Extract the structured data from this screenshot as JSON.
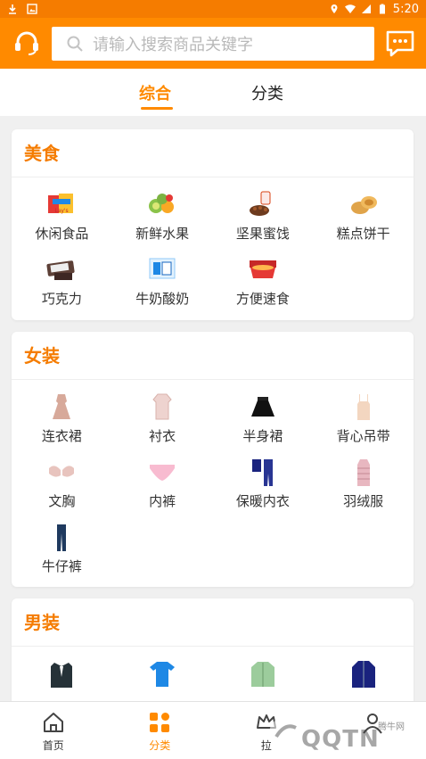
{
  "status_bar": {
    "time": "5:20"
  },
  "search": {
    "placeholder": "请输入搜索商品关键字"
  },
  "tabs": [
    {
      "label": "综合"
    },
    {
      "label": "分类"
    }
  ],
  "sections": [
    {
      "title": "美食",
      "items": [
        {
          "label": "休闲食品",
          "icon": "snacks-icon"
        },
        {
          "label": "新鲜水果",
          "icon": "fruit-icon"
        },
        {
          "label": "坚果蜜饯",
          "icon": "nuts-icon"
        },
        {
          "label": "糕点饼干",
          "icon": "pastry-icon"
        },
        {
          "label": "巧克力",
          "icon": "chocolate-icon"
        },
        {
          "label": "牛奶酸奶",
          "icon": "milk-icon"
        },
        {
          "label": "方便速食",
          "icon": "instant-food-icon"
        }
      ]
    },
    {
      "title": "女装",
      "items": [
        {
          "label": "连衣裙",
          "icon": "dress-icon"
        },
        {
          "label": "衬衣",
          "icon": "blouse-icon"
        },
        {
          "label": "半身裙",
          "icon": "skirt-icon"
        },
        {
          "label": "背心吊带",
          "icon": "camisole-icon"
        },
        {
          "label": "文胸",
          "icon": "bra-icon"
        },
        {
          "label": "内裤",
          "icon": "underwear-icon"
        },
        {
          "label": "保暖内衣",
          "icon": "thermal-wear-icon"
        },
        {
          "label": "羽绒服",
          "icon": "down-coat-icon"
        },
        {
          "label": "牛仔裤",
          "icon": "jeans-icon"
        }
      ]
    },
    {
      "title": "男装",
      "items": [
        {
          "label": "",
          "icon": "suit-icon"
        },
        {
          "label": "",
          "icon": "tshirt-icon"
        },
        {
          "label": "",
          "icon": "shirt-icon"
        },
        {
          "label": "",
          "icon": "jacket-icon"
        }
      ]
    }
  ],
  "bottom_nav": [
    {
      "label": "首页",
      "icon": "home-icon"
    },
    {
      "label": "分类",
      "icon": "category-icon",
      "active": true
    },
    {
      "label": "拉",
      "icon": "crown-icon"
    },
    {
      "label": "",
      "icon": "profile-icon"
    }
  ],
  "watermark": {
    "text": "QQTN",
    "small": "腾牛网"
  },
  "colors": {
    "brand": "#ff8a00",
    "status_bar": "#f57c00",
    "section_title": "#f57c00"
  }
}
